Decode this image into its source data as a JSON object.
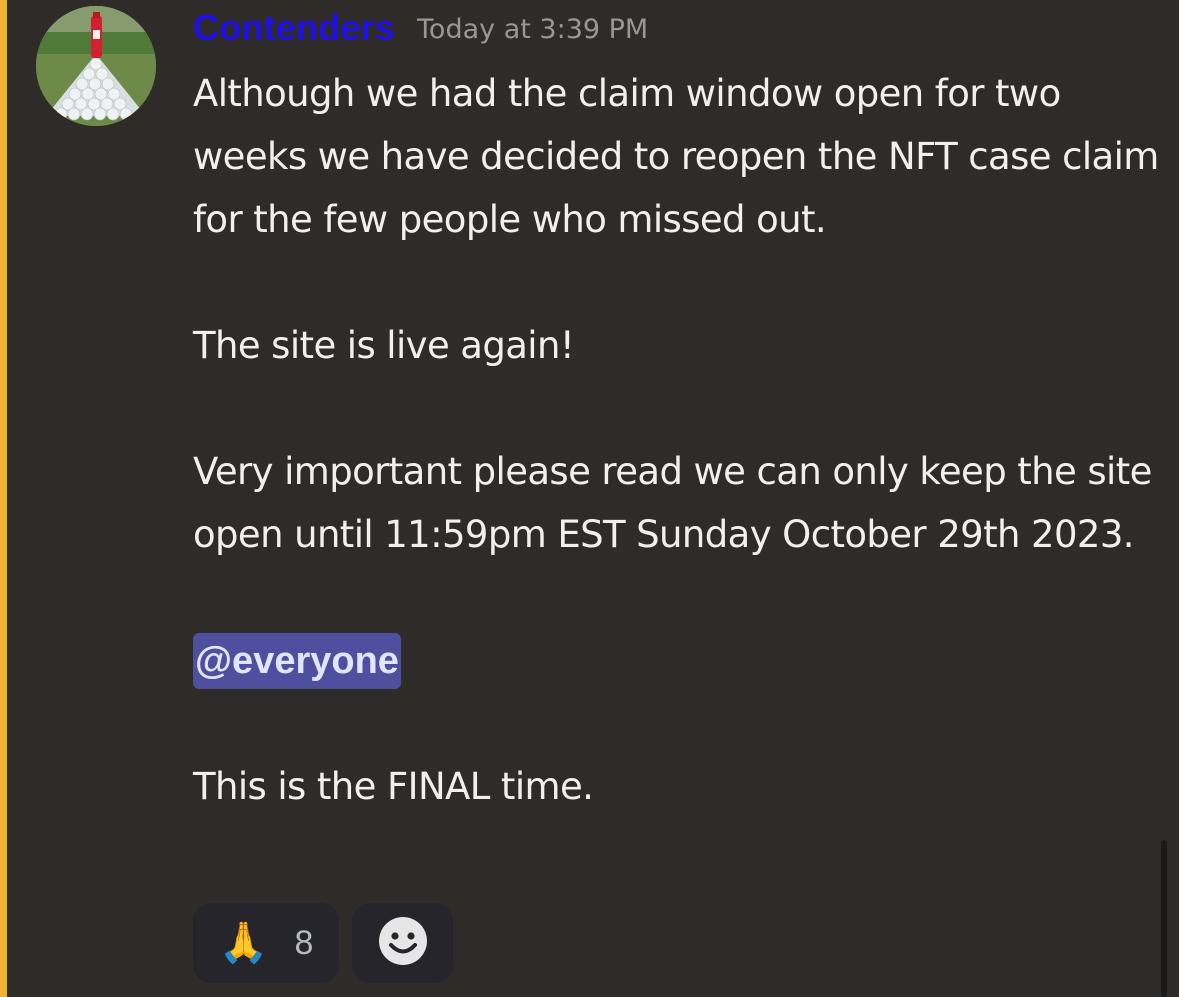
{
  "message": {
    "author": "Contenders",
    "timestamp": "Today at 3:39 PM",
    "paragraphs": [
      "Although we had the claim window open for two weeks we have decided to reopen the NFT case claim for the few people who missed out.",
      "The site is live again!",
      "Very important please read we can only keep the site open until 11:59pm EST Sunday October 29th 2023."
    ],
    "mention": "@everyone",
    "final_line": "This is the FINAL time."
  },
  "reactions": [
    {
      "emoji": "🙏",
      "icon": "folded-hands-icon",
      "count": "8"
    }
  ],
  "add_reaction": {
    "icon": "smiley-add-reaction-icon"
  },
  "colors": {
    "background": "#2f2b28",
    "mention_highlight_bar": "#f0b232",
    "username": "#1f10e6",
    "mention_bg": "#4e4f9e"
  }
}
